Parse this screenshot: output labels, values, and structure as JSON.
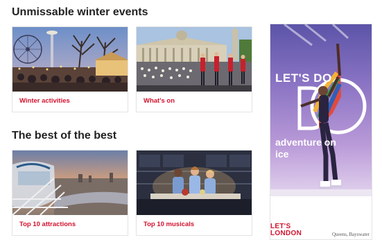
{
  "sections": {
    "winter_heading": "Unmissable winter events",
    "best_heading": "The best of the best"
  },
  "cards": {
    "winter_activities": {
      "label": "Winter activities",
      "image": "london-eye-winter-market-photo"
    },
    "whats_on": {
      "label": "What's on",
      "image": "trafalgar-square-crowd-photo"
    },
    "top_attractions": {
      "label": "Top 10 attractions",
      "image": "london-eye-capsule-view-photo"
    },
    "top_musicals": {
      "label": "Top 10 musicals",
      "image": "musical-stage-performers-photo"
    }
  },
  "advert": {
    "headline": "LET'S DO",
    "subline": "adventure on ice",
    "logo_line1": "LET'S",
    "logo_line2": "LONDON",
    "caption": "Queens, Bayswater",
    "accent_color": "#d2122e"
  }
}
